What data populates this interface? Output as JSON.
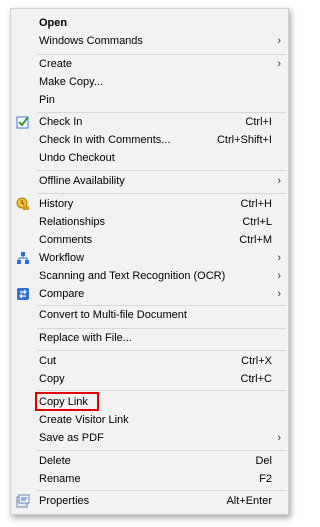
{
  "menu": {
    "open": "Open",
    "windows_commands": "Windows Commands",
    "create": "Create",
    "make_copy": "Make Copy...",
    "pin": "Pin",
    "check_in": "Check In",
    "check_in_shortcut": "Ctrl+I",
    "check_in_comments": "Check In with Comments...",
    "check_in_comments_shortcut": "Ctrl+Shift+I",
    "undo_checkout": "Undo Checkout",
    "offline_availability": "Offline Availability",
    "history": "History",
    "history_shortcut": "Ctrl+H",
    "relationships": "Relationships",
    "relationships_shortcut": "Ctrl+L",
    "comments": "Comments",
    "comments_shortcut": "Ctrl+M",
    "workflow": "Workflow",
    "scanning": "Scanning and Text Recognition (OCR)",
    "compare": "Compare",
    "convert": "Convert to Multi-file Document",
    "replace": "Replace with File...",
    "cut": "Cut",
    "cut_shortcut": "Ctrl+X",
    "copy": "Copy",
    "copy_shortcut": "Ctrl+C",
    "copy_link": "Copy Link",
    "create_visitor_link": "Create Visitor Link",
    "save_as_pdf": "Save as PDF",
    "delete": "Delete",
    "delete_shortcut": "Del",
    "rename": "Rename",
    "rename_shortcut": "F2",
    "properties": "Properties",
    "properties_shortcut": "Alt+Enter",
    "submenu_arrow": "›"
  },
  "colors": {
    "highlight_border": "#e00000",
    "menu_background": "#f2f2f2"
  },
  "icons": [
    "check-in-icon",
    "history-icon",
    "workflow-icon",
    "compare-icon",
    "properties-icon"
  ]
}
